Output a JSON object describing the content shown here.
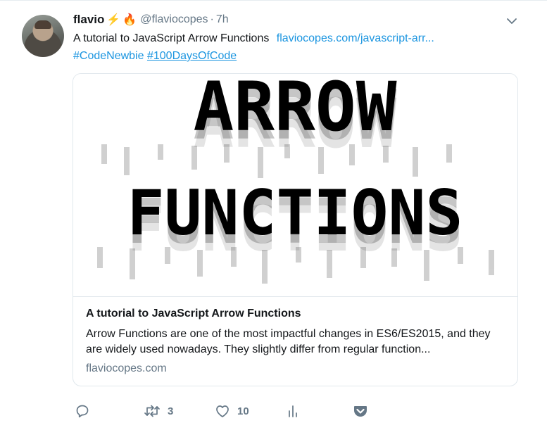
{
  "tweet": {
    "name": "flavio",
    "emoji_1": "⚡",
    "emoji_2": "🔥",
    "handle": "@flaviocopes",
    "separator": "·",
    "time": "7h",
    "text_plain": "A tutorial to JavaScript Arrow Functions",
    "link_text": "flaviocopes.com/javascript-arr...",
    "hashtag_1": "#CodeNewbie",
    "hashtag_2": "#100DaysOfCode",
    "avatar_icon": "user-avatar",
    "menu_icon": "chevron-down-icon"
  },
  "card": {
    "image_line_1": "ARROW",
    "image_line_2": "FUNCTIONS",
    "title": "A tutorial to JavaScript Arrow Functions",
    "description": "Arrow Functions are one of the most impactful changes in ES6/ES2015, and they are widely used nowadays. They slightly differ from regular function...",
    "domain": "flaviocopes.com"
  },
  "actions": {
    "reply_icon": "reply-icon",
    "retweet_icon": "retweet-icon",
    "retweet_count": "3",
    "like_icon": "heart-icon",
    "like_count": "10",
    "analytics_icon": "analytics-icon",
    "pocket_icon": "pocket-icon"
  },
  "colors": {
    "link": "#1b95e0",
    "secondary_text": "#657786",
    "border": "#e1e8ed",
    "pocket": "#657786"
  }
}
